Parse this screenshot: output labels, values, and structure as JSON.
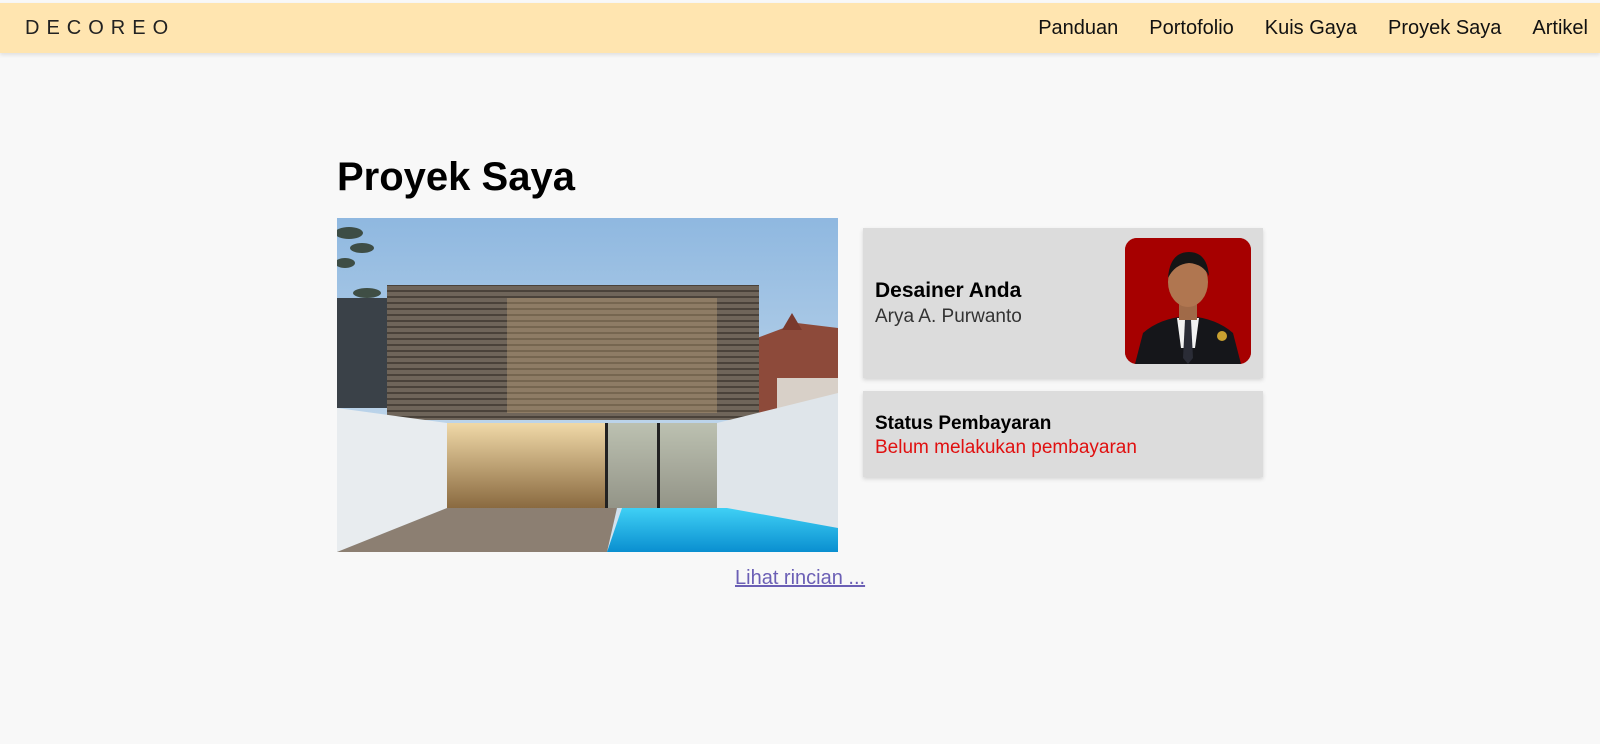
{
  "navbar": {
    "logo": "DECOREO",
    "links": [
      "Panduan",
      "Portofolio",
      "Kuis Gaya",
      "Proyek Saya",
      "Artikel"
    ]
  },
  "main": {
    "title": "Proyek Saya",
    "designer_card": {
      "title": "Desainer Anda",
      "name": "Arya A. Purwanto"
    },
    "payment_card": {
      "title": "Status Pembayaran",
      "status": "Belum melakukan pembayaran"
    },
    "details_link": "Lihat rincian ..."
  },
  "colors": {
    "navbar_bg": "#ffe5b0",
    "card_bg": "#dcdcdc",
    "status_unpaid": "#e01010",
    "link": "#6b5fb5"
  }
}
